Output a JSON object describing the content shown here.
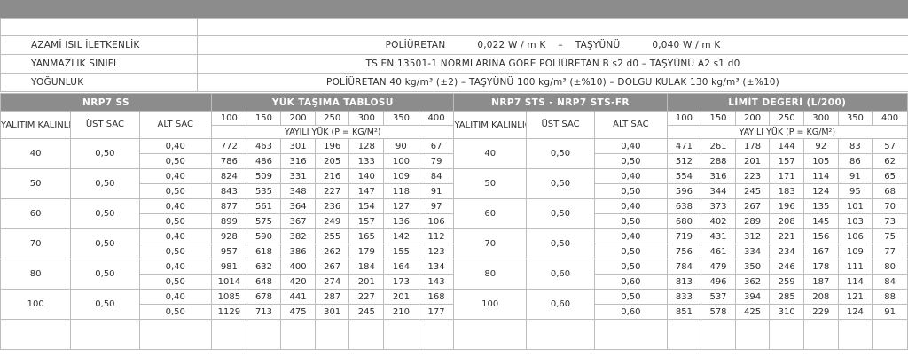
{
  "properties": {
    "conductivity": {
      "label": "AZAMİ ISIL İLETKENLİK",
      "pu_name": "POLİÜRETAN",
      "pu_value": "0,022 W / m K",
      "sep": "–",
      "rw_name": "TAŞYÜNÜ",
      "rw_value": "0,040 W / m K"
    },
    "fire": {
      "label": "YANMAZLIK SINIFI",
      "value": "TS EN 13501-1 NORMLARINA GÖRE  POLİÜRETAN B s2 d0  –  TAŞYÜNÜ A2 s1 d0"
    },
    "density": {
      "label": "YOĞUNLUK",
      "value": "POLİÜRETAN  40 kg/m³ (±2)  –  TAŞYÜNÜ  100 kg/m³ (±%10)  –  DOLGU KULAK 130 kg/m³ (±%10)"
    }
  },
  "load_table": {
    "left": {
      "product": "NRP7 SS",
      "title": "YÜK TAŞIMA TABLOSU",
      "col_thickness": "YALITIM KALINLIĞI",
      "col_top": "ÜST SAC",
      "col_bottom": "ALT SAC",
      "spans": [
        "100",
        "150",
        "200",
        "250",
        "300",
        "350",
        "400"
      ],
      "unit": "YAYILI YÜK (P = KG/M²)",
      "groups": [
        {
          "thickness": "40",
          "top": "0,50",
          "rows": [
            {
              "bottom": "0,40",
              "values": [
                "772",
                "463",
                "301",
                "196",
                "128",
                "90",
                "67"
              ]
            },
            {
              "bottom": "0,50",
              "values": [
                "786",
                "486",
                "316",
                "205",
                "133",
                "100",
                "79"
              ]
            }
          ]
        },
        {
          "thickness": "50",
          "top": "0,50",
          "rows": [
            {
              "bottom": "0,40",
              "values": [
                "824",
                "509",
                "331",
                "216",
                "140",
                "109",
                "84"
              ]
            },
            {
              "bottom": "0,50",
              "values": [
                "843",
                "535",
                "348",
                "227",
                "147",
                "118",
                "91"
              ]
            }
          ]
        },
        {
          "thickness": "60",
          "top": "0,50",
          "rows": [
            {
              "bottom": "0,40",
              "values": [
                "877",
                "561",
                "364",
                "236",
                "154",
                "127",
                "97"
              ]
            },
            {
              "bottom": "0,50",
              "values": [
                "899",
                "575",
                "367",
                "249",
                "157",
                "136",
                "106"
              ]
            }
          ]
        },
        {
          "thickness": "70",
          "top": "0,50",
          "rows": [
            {
              "bottom": "0,40",
              "values": [
                "928",
                "590",
                "382",
                "255",
                "165",
                "142",
                "112"
              ]
            },
            {
              "bottom": "0,50",
              "values": [
                "957",
                "618",
                "386",
                "262",
                "179",
                "155",
                "123"
              ]
            }
          ]
        },
        {
          "thickness": "80",
          "top": "0,50",
          "rows": [
            {
              "bottom": "0,40",
              "values": [
                "981",
                "632",
                "400",
                "267",
                "184",
                "164",
                "134"
              ]
            },
            {
              "bottom": "0,50",
              "values": [
                "1014",
                "648",
                "420",
                "274",
                "201",
                "173",
                "143"
              ]
            }
          ]
        },
        {
          "thickness": "100",
          "top": "0,50",
          "rows": [
            {
              "bottom": "0,40",
              "values": [
                "1085",
                "678",
                "441",
                "287",
                "227",
                "201",
                "168"
              ]
            },
            {
              "bottom": "0,50",
              "values": [
                "1129",
                "713",
                "475",
                "301",
                "245",
                "210",
                "177"
              ]
            }
          ]
        }
      ]
    },
    "right": {
      "product": "NRP7 STS - NRP7 STS-FR",
      "title": "LİMİT DEĞERİ (L/200)",
      "col_thickness": "YALITIM KALINLIĞI",
      "col_top": "ÜST SAC",
      "col_bottom": "ALT SAC",
      "spans": [
        "100",
        "150",
        "200",
        "250",
        "300",
        "350",
        "400"
      ],
      "unit": "YAYILI YÜK (P = KG/M²)",
      "groups": [
        {
          "thickness": "40",
          "top": "0,50",
          "rows": [
            {
              "bottom": "0,40",
              "values": [
                "471",
                "261",
                "178",
                "144",
                "92",
                "83",
                "57"
              ]
            },
            {
              "bottom": "0,50",
              "values": [
                "512",
                "288",
                "201",
                "157",
                "105",
                "86",
                "62"
              ]
            }
          ]
        },
        {
          "thickness": "50",
          "top": "0,50",
          "rows": [
            {
              "bottom": "0,40",
              "values": [
                "554",
                "316",
                "223",
                "171",
                "114",
                "91",
                "65"
              ]
            },
            {
              "bottom": "0,50",
              "values": [
                "596",
                "344",
                "245",
                "183",
                "124",
                "95",
                "68"
              ]
            }
          ]
        },
        {
          "thickness": "60",
          "top": "0,50",
          "rows": [
            {
              "bottom": "0,40",
              "values": [
                "638",
                "373",
                "267",
                "196",
                "135",
                "101",
                "70"
              ]
            },
            {
              "bottom": "0,50",
              "values": [
                "680",
                "402",
                "289",
                "208",
                "145",
                "103",
                "73"
              ]
            }
          ]
        },
        {
          "thickness": "70",
          "top": "0,50",
          "rows": [
            {
              "bottom": "0,40",
              "values": [
                "719",
                "431",
                "312",
                "221",
                "156",
                "106",
                "75"
              ]
            },
            {
              "bottom": "0,50",
              "values": [
                "756",
                "461",
                "334",
                "234",
                "167",
                "109",
                "77"
              ]
            }
          ]
        },
        {
          "thickness": "80",
          "top": "0,60",
          "rows": [
            {
              "bottom": "0,50",
              "values": [
                "784",
                "479",
                "350",
                "246",
                "178",
                "111",
                "80"
              ]
            },
            {
              "bottom": "0,60",
              "values": [
                "813",
                "496",
                "362",
                "259",
                "187",
                "114",
                "84"
              ]
            }
          ]
        },
        {
          "thickness": "100",
          "top": "0,60",
          "rows": [
            {
              "bottom": "0,50",
              "values": [
                "833",
                "537",
                "394",
                "285",
                "208",
                "121",
                "88"
              ]
            },
            {
              "bottom": "0,60",
              "values": [
                "851",
                "578",
                "425",
                "310",
                "229",
                "124",
                "91"
              ]
            }
          ]
        }
      ]
    }
  }
}
